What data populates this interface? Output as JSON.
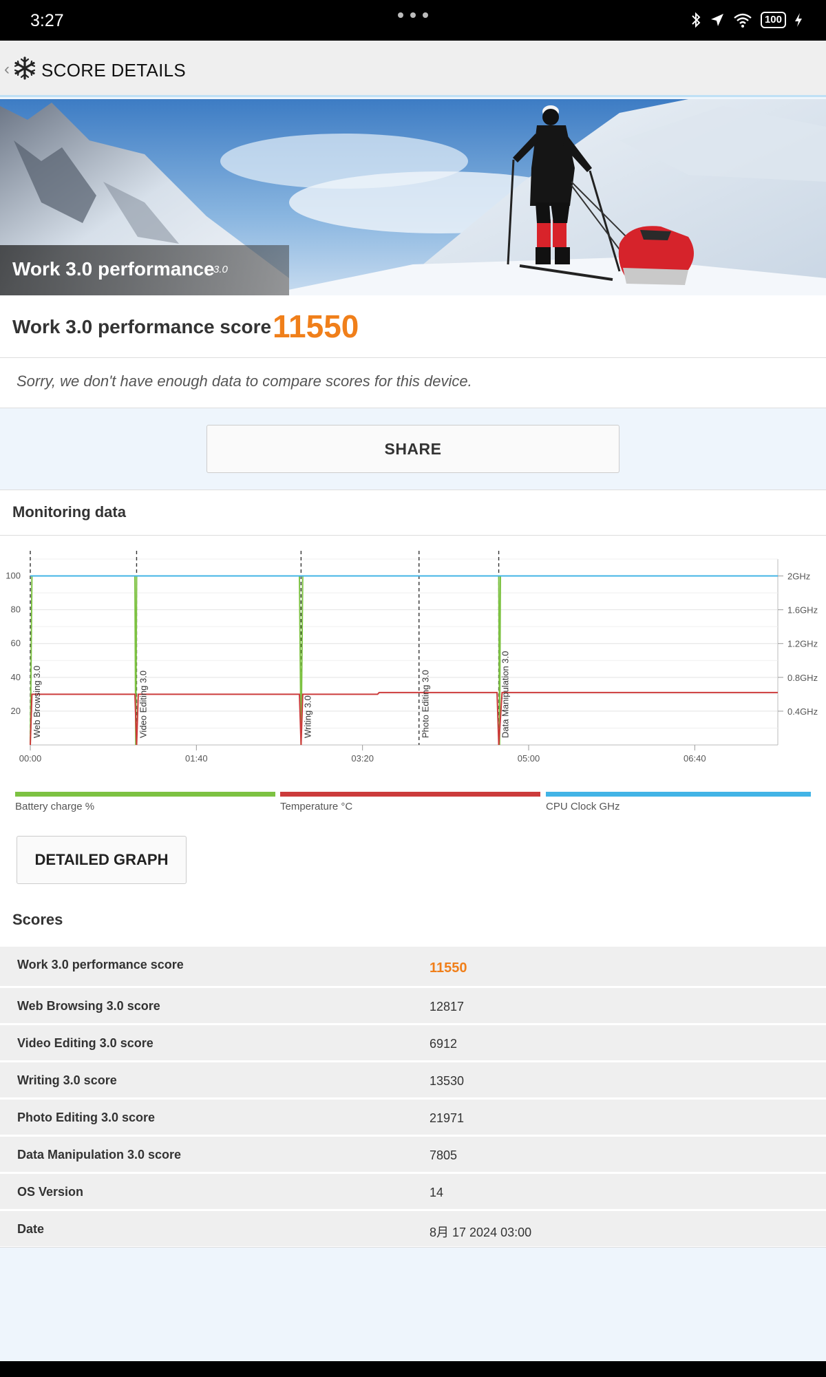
{
  "status_bar": {
    "time": "3:27",
    "battery": "100"
  },
  "header": {
    "title": "SCORE DETAILS"
  },
  "hero": {
    "title": "Work 3.0 performance",
    "version": "3.0"
  },
  "summary": {
    "score_label": "Work 3.0 performance score",
    "score_value": "11550",
    "compare_note": "Sorry, we don't have enough data to compare scores for this device."
  },
  "share_label": "SHARE",
  "monitoring": {
    "title": "Monitoring data",
    "legend": [
      {
        "label": "Battery charge %",
        "color": "#7dc242"
      },
      {
        "label": "Temperature °C",
        "color": "#cc3b3b"
      },
      {
        "label": "CPU Clock GHz",
        "color": "#42b4e6"
      }
    ],
    "detailed_graph_label": "DETAILED GRAPH"
  },
  "chart_data": {
    "type": "line",
    "x_ticks": [
      "00:00",
      "01:40",
      "03:20",
      "05:00",
      "06:40"
    ],
    "x_range_seconds": [
      0,
      450
    ],
    "y_left_ticks": [
      "20",
      "40",
      "60",
      "80",
      "100"
    ],
    "y_left_range": [
      0,
      110
    ],
    "y_right_ticks": [
      "0.4GHz",
      "0.8GHz",
      "1.2GHz",
      "1.6GHz",
      "2GHz"
    ],
    "y_right_range_ghz": [
      0,
      2.2
    ],
    "grid": true,
    "markers": [
      {
        "label": "Web Browsing 3.0",
        "t": 0
      },
      {
        "label": "Video Editing 3.0",
        "t": 64
      },
      {
        "label": "Writing 3.0",
        "t": 163
      },
      {
        "label": "Photo Editing 3.0",
        "t": 234
      },
      {
        "label": "Data Manipulation 3.0",
        "t": 282
      }
    ],
    "series": [
      {
        "name": "Battery charge %",
        "color": "#7dc242",
        "points": [
          [
            0,
            0
          ],
          [
            1,
            100
          ],
          [
            63,
            100
          ],
          [
            63.5,
            0
          ],
          [
            64,
            100
          ],
          [
            65,
            100
          ],
          [
            162,
            100
          ],
          [
            163,
            0
          ],
          [
            164,
            100
          ],
          [
            282,
            100
          ],
          [
            282.5,
            0
          ],
          [
            283,
            100
          ],
          [
            284,
            100
          ]
        ]
      },
      {
        "name": "Temperature °C",
        "color": "#cc3b3b",
        "points": [
          [
            0,
            0
          ],
          [
            1,
            30
          ],
          [
            63,
            30
          ],
          [
            64,
            0
          ],
          [
            65,
            30
          ],
          [
            162,
            30
          ],
          [
            163,
            0
          ],
          [
            164,
            30
          ],
          [
            209,
            30
          ],
          [
            210,
            31
          ],
          [
            281,
            31
          ],
          [
            282,
            0
          ],
          [
            284,
            31
          ],
          [
            450,
            31
          ]
        ]
      },
      {
        "name": "CPU Clock GHz",
        "color": "#42b4e6",
        "axis": "right",
        "points": [
          [
            0,
            2.0
          ],
          [
            450,
            2.0
          ]
        ]
      }
    ]
  },
  "scores": {
    "title": "Scores",
    "rows": [
      {
        "label": "Work 3.0 performance score",
        "value": "11550"
      },
      {
        "label": "Web Browsing 3.0 score",
        "value": "12817"
      },
      {
        "label": "Video Editing 3.0 score",
        "value": "6912"
      },
      {
        "label": "Writing 3.0 score",
        "value": "13530"
      },
      {
        "label": "Photo Editing 3.0 score",
        "value": "21971"
      },
      {
        "label": "Data Manipulation 3.0 score",
        "value": "7805"
      },
      {
        "label": "OS Version",
        "value": "14"
      },
      {
        "label": "Date",
        "value": "8月 17 2024 03:00"
      }
    ]
  }
}
